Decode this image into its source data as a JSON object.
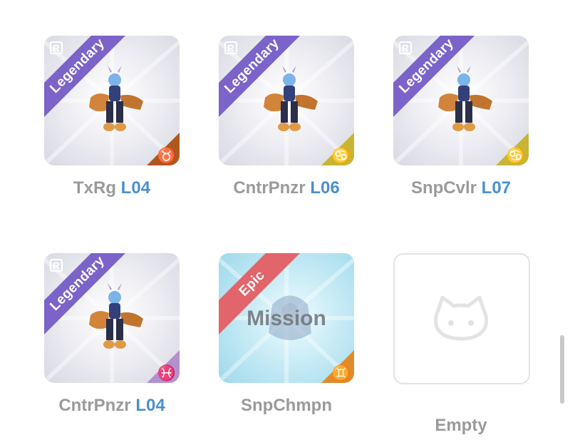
{
  "cards": [
    {
      "name": "TxRg",
      "level": "L04",
      "rarity": "Legendary",
      "rank_badge": "R",
      "zodiac_icon": "taurus-icon",
      "zodiac_glyph": "♉",
      "zodiac_color": "#b0571e",
      "overlay": ""
    },
    {
      "name": "CntrPnzr",
      "level": "L06",
      "rarity": "Legendary",
      "rank_badge": "R",
      "zodiac_icon": "cancer-icon",
      "zodiac_glyph": "♋",
      "zodiac_color": "#c9b433",
      "overlay": ""
    },
    {
      "name": "SnpCvlr",
      "level": "L07",
      "rarity": "Legendary",
      "rank_badge": "R",
      "zodiac_icon": "cancer-icon",
      "zodiac_glyph": "♋",
      "zodiac_color": "#c9b433",
      "overlay": ""
    },
    {
      "name": "CntrPnzr",
      "level": "L04",
      "rarity": "Legendary",
      "rank_badge": "R",
      "zodiac_icon": "pisces-icon",
      "zodiac_glyph": "♓",
      "zodiac_color": "#b58fd0",
      "overlay": ""
    },
    {
      "name": "SnpChmpn",
      "level": "",
      "rarity": "Epic",
      "rank_badge": "",
      "zodiac_icon": "gemini-icon",
      "zodiac_glyph": "♊",
      "zodiac_color": "#e08a2c",
      "overlay": "Mission"
    }
  ],
  "empty_slot": {
    "label": "Empty",
    "icon": "cat-face-icon"
  },
  "colors": {
    "legendary": "#7b63c9",
    "epic": "#e2656c",
    "level_text": "#4a8fd0",
    "name_text": "#9a9a9a"
  }
}
